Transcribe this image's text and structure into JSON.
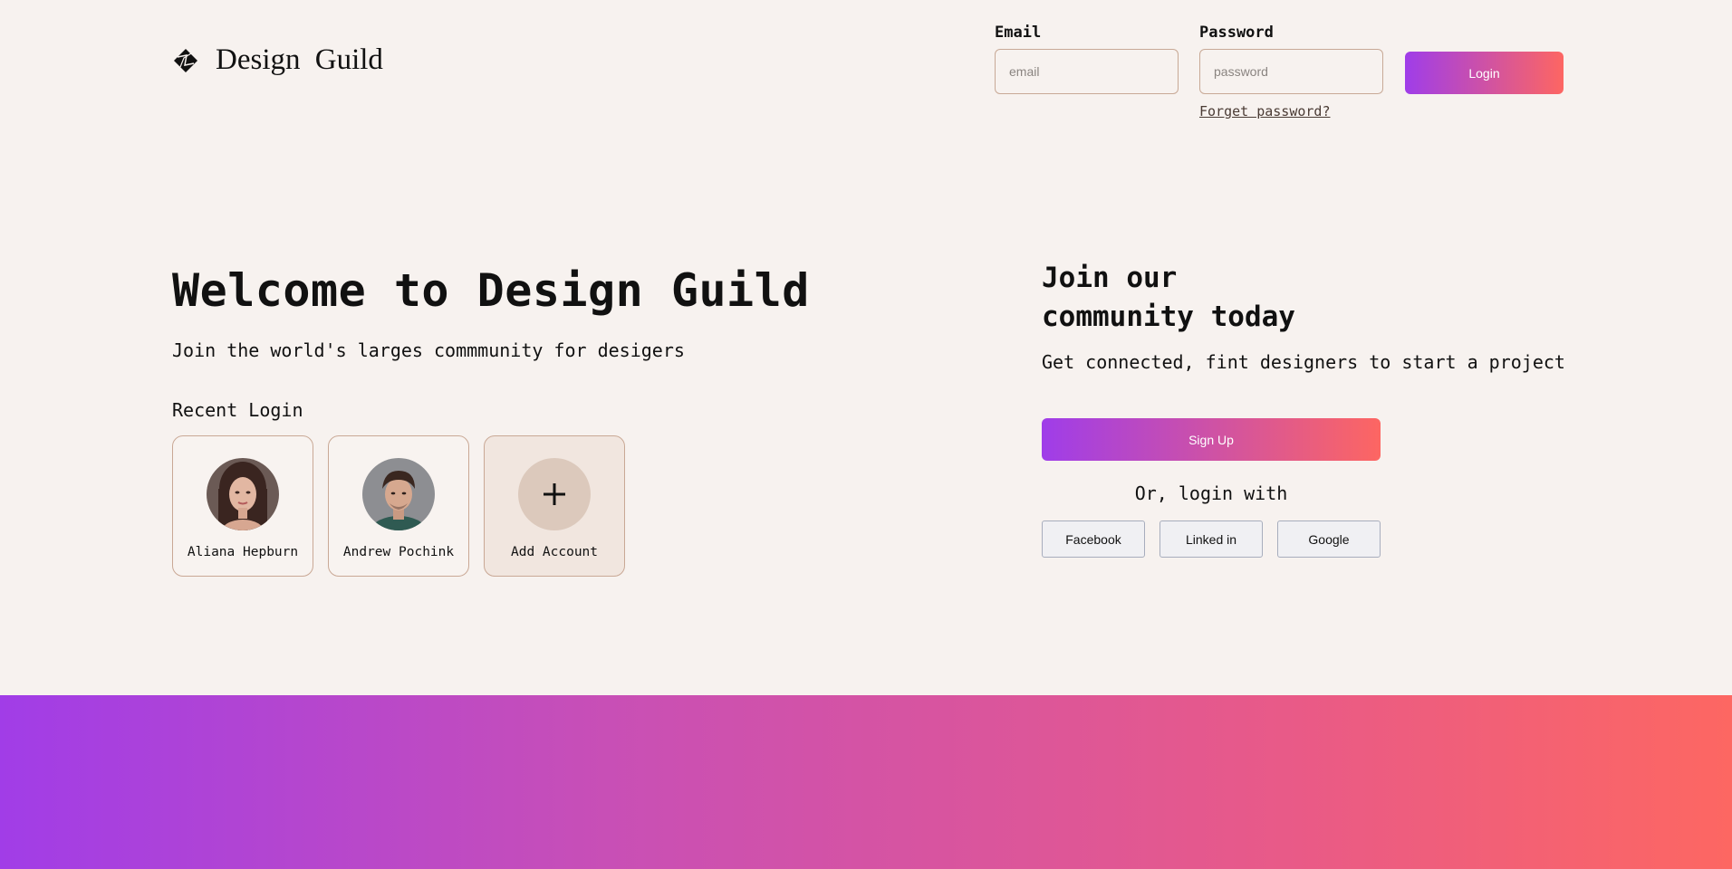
{
  "header": {
    "brand_name": "Design  Guild",
    "email_label": "Email",
    "email_placeholder": "email",
    "password_label": "Password",
    "password_placeholder": "password",
    "login_label": "Login",
    "forget_password": "Forget password?"
  },
  "hero": {
    "title": "Welcome to Design Guild",
    "subtitle": "Join the world's larges commmunity for desigers",
    "recent_heading": "Recent Login",
    "accounts": [
      {
        "name": "Aliana Hepburn",
        "avatar": "woman-portrait"
      },
      {
        "name": "Andrew Pochink",
        "avatar": "man-portrait"
      }
    ],
    "add_account_label": "Add Account"
  },
  "join": {
    "title_line1": "Join our",
    "title_line2": "community today",
    "subtitle": "Get connected, fint designers to start a project",
    "signup_label": "Sign Up",
    "or_login": "Or, login with",
    "social": [
      "Facebook",
      "Linked in",
      "Google"
    ]
  },
  "colors": {
    "background": "#f7f2ef",
    "gradient_start": "#9f3de9",
    "gradient_end": "#fd6662",
    "card_border": "#c9a895"
  }
}
